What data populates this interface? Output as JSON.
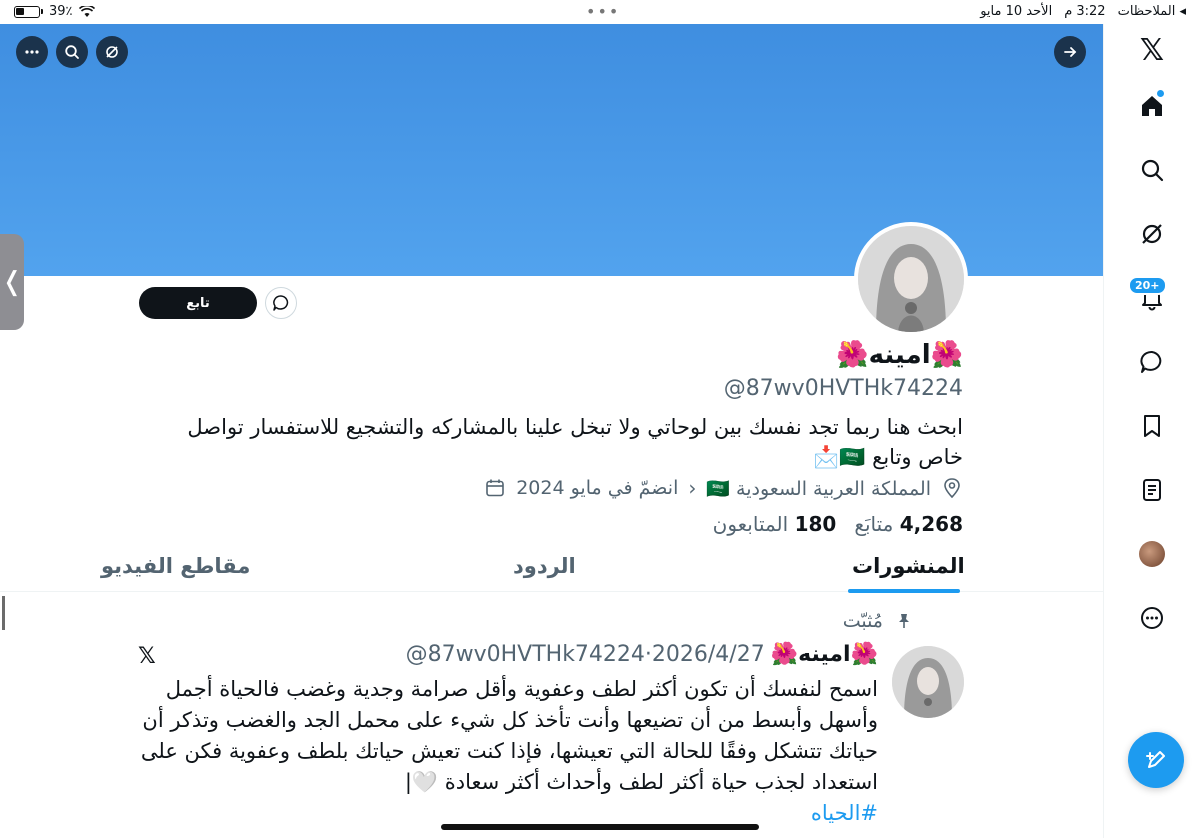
{
  "status_bar": {
    "battery": "39٪",
    "app_back": "الملاحظات",
    "time": "3:22 م",
    "date": "الأحد 10 مايو"
  },
  "profile": {
    "name": "امينه",
    "name_emoji": "🌺",
    "handle": "@87wv0HVTHk74224",
    "bio": "ابحث هنا ربما تجد نفسك بين لوحاتي ولا تبخل علينا بالمشاركه والتشجيع للاستفسار تواصل خاص وتابع 🇸🇦📩",
    "location": "المملكة العربية السعودية 🇸🇦",
    "joined": "انضمّ في مايو 2024",
    "following_count": "180",
    "following_label": "متابَع",
    "followers_count": "4,268",
    "followers_label": "المتابعون",
    "follow_label": "تابع"
  },
  "tabs": [
    "المنشورات",
    "الردود",
    "مقاطع الفيديو"
  ],
  "post": {
    "pinned_label": "مُثبّت",
    "author": "امينه",
    "handle_date": "@87wv0HVTHk74224·2026/4/27",
    "text": "اسمح لنفسك أن تكون أكثر لطف وعفوية وأقل صرامة وجدية وغضب فالحياة أجمل وأسهل وأبسط من أن تضيعها وأنت تأخذ كل شيء على محمل الجد والغضب وتذكر أن حياتك تتشكل وفقًا للحالة التي تعيشها، فإذا كنت تعيش حياتك بلطف وعفوية فكن على استعداد لجذب حياة أكثر لطف وأحداث أكثر سعادة 🤍|",
    "hashtag": "#الحياه"
  },
  "rail": {
    "logo": "𝕏",
    "notifications_badge": "20+"
  },
  "icons": [
    "x-logo-icon",
    "home-icon",
    "search-icon",
    "grok-icon",
    "bell-icon",
    "chat-icon",
    "bookmark-icon",
    "list-icon",
    "avatar",
    "more-icon",
    "compose-icon"
  ],
  "colors": {
    "accent": "#1d9bf0",
    "banner": "#4a9ae8",
    "text": "#0f1419",
    "muted": "#536471"
  }
}
